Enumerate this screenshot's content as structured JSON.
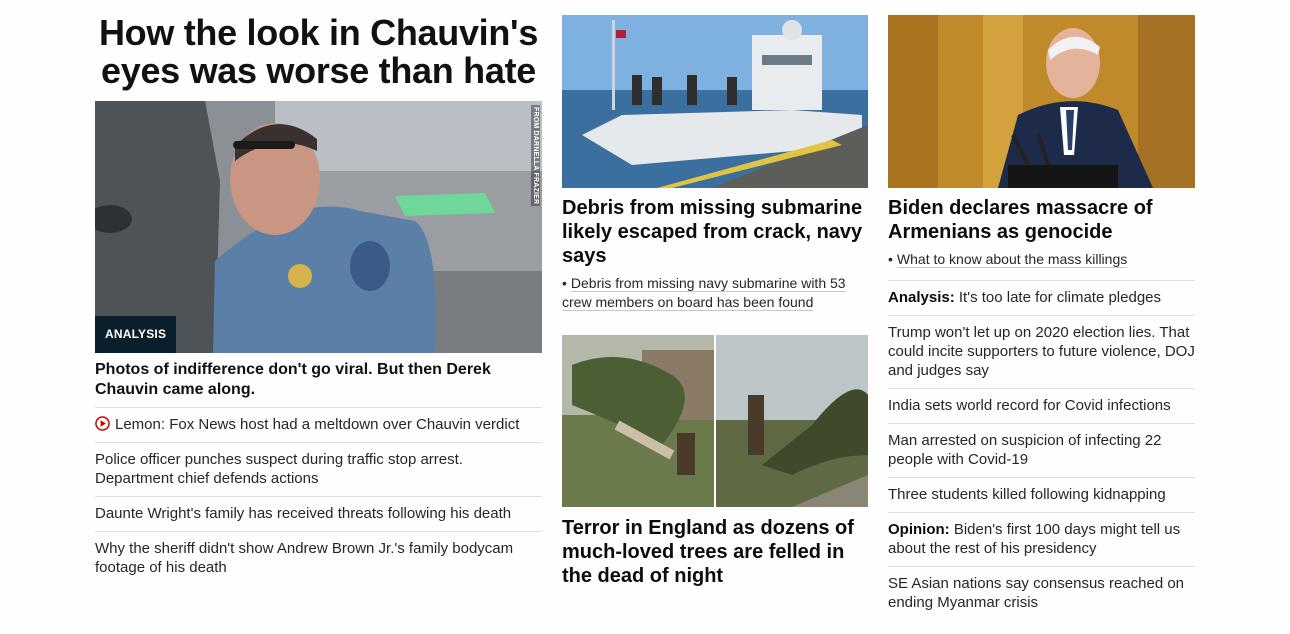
{
  "col1": {
    "headline": "How the look in Chauvin's eyes was worse than hate",
    "image_credit": "FROM DARNELLA FRAZIER",
    "badge": "ANALYSIS",
    "caption": "Photos of indifference don't go viral. But then Derek Chauvin came along.",
    "items": [
      {
        "text": "Lemon: Fox News host had a meltdown over Chauvin verdict",
        "icon": "play-video-icon"
      },
      {
        "text": "Police officer punches suspect during traffic stop arrest. Department chief defends actions"
      },
      {
        "text": "Daunte Wright's family has received threats following his death"
      },
      {
        "text": "Why the sheriff didn't show Andrew Brown Jr.'s family bodycam footage of his death"
      }
    ]
  },
  "col2": {
    "story1": {
      "title": "Debris from missing submarine likely escaped from crack, navy says",
      "sub_link": "Debris from missing navy submarine with 53 crew members on board has been found"
    },
    "story2": {
      "title": "Terror in England as dozens of much-loved trees are felled in the dead of night"
    }
  },
  "col3": {
    "story": {
      "title": "Biden declares massacre of Armenians as genocide",
      "sub_link": "What to know about the mass killings"
    },
    "items": [
      {
        "prefix": "Analysis:",
        "text": "It's too late for climate pledges"
      },
      {
        "text": "Trump won't let up on 2020 election lies. That could incite supporters to future violence, DOJ and judges say"
      },
      {
        "text": "India sets world record for Covid infections"
      },
      {
        "text": "Man arrested on suspicion of infecting 22 people with Covid-19"
      },
      {
        "text": "Three students killed following kidnapping"
      },
      {
        "prefix": "Opinion:",
        "text": "Biden's first 100 days might tell us about the rest of his presidency"
      },
      {
        "text": "SE Asian nations say consensus reached on ending Myanmar crisis"
      }
    ]
  },
  "colors": {
    "badge_bg": "#0b1e2b",
    "play_icon": "#cc0000",
    "divider": "#dedede"
  }
}
